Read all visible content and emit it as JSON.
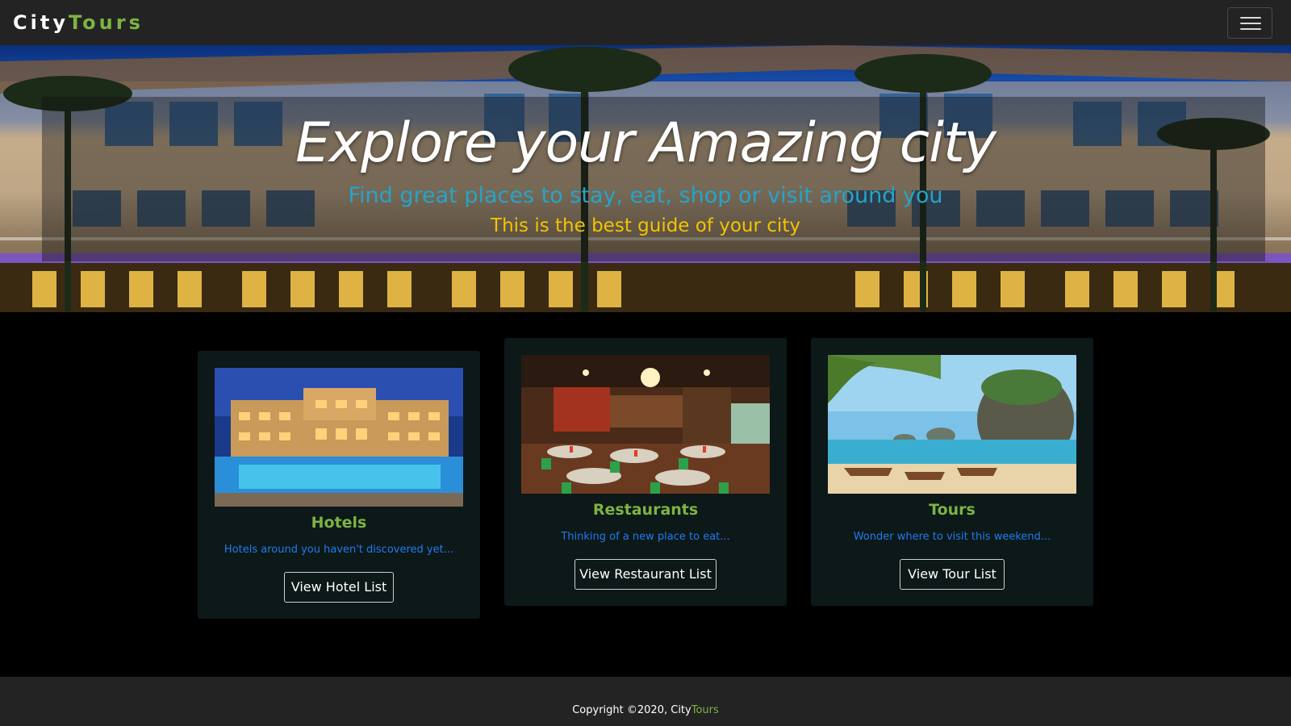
{
  "navbar": {
    "brand_part1": "City",
    "brand_part2": "Tours",
    "menu_icon": "hamburger-icon"
  },
  "hero": {
    "title": "Explore your Amazing city",
    "subtitle": "Find great places to stay, eat, shop or visit around you",
    "tagline": "This is the best guide of your city"
  },
  "cards": [
    {
      "title": "Hotels",
      "description": "Hotels around you haven't discovered yet...",
      "button": "View Hotel List"
    },
    {
      "title": "Restaurants",
      "description": "Thinking of a new place to eat...",
      "button": "View Restaurant List"
    },
    {
      "title": "Tours",
      "description": "Wonder where to visit this weekend...",
      "button": "View Tour List"
    }
  ],
  "footer": {
    "copyright": "Copyright ©2020, City",
    "brand_accent": "Tours"
  },
  "colors": {
    "accent_green": "#7cb342",
    "subtitle_blue": "#25a4c9",
    "tagline_yellow": "#f2c400",
    "desc_blue": "#1e7cf0",
    "navbar_bg": "#232323",
    "card_bg": "#0d1818"
  }
}
